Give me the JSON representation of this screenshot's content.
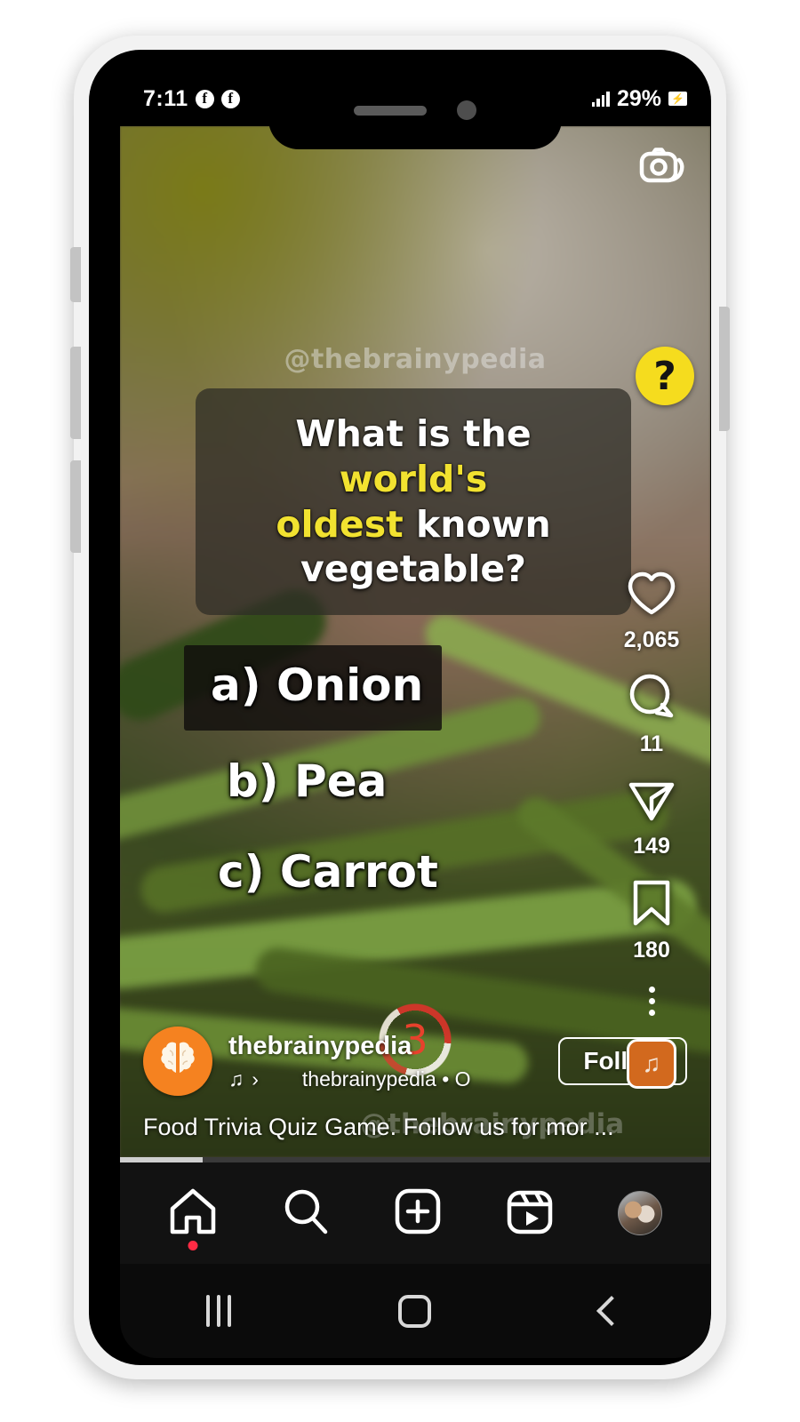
{
  "status_bar": {
    "clock": "7:11",
    "notification_icons": [
      "facebook-icon",
      "facebook-icon"
    ],
    "battery_percent": "29%",
    "signal_icon": "signal-bars-icon",
    "battery_icon": "battery-charging-icon"
  },
  "video": {
    "watermark_top": "@thebrainypedia",
    "watermark_bottom": "@thebrainypedia",
    "camera_icon": "camera-remix-icon"
  },
  "quiz": {
    "badge": "?",
    "question_part1": "What is the ",
    "question_highlight1": "world's",
    "question_highlight2": "oldest",
    "question_part2": " known",
    "question_part3": "vegetable?",
    "answers": [
      {
        "label": "a) Onion"
      },
      {
        "label": "b) Pea"
      },
      {
        "label": "c) Carrot"
      }
    ],
    "countdown": "3"
  },
  "actions": {
    "like": {
      "icon": "heart-icon",
      "count": "2,065"
    },
    "comment": {
      "icon": "comment-icon",
      "count": "11"
    },
    "share": {
      "icon": "send-icon",
      "count": "149"
    },
    "save": {
      "icon": "bookmark-icon",
      "count": "180"
    },
    "more": {
      "icon": "more-options-icon"
    },
    "audio_thumb": {
      "icon": "music-note-icon"
    }
  },
  "post": {
    "username": "thebrainypedia",
    "avatar_icon": "brain-icon",
    "music_icon": "music-note-icon",
    "audio_title": "thebrainypedia • O",
    "follow_label": "Follow",
    "caption": "Food Trivia Quiz Game. Follow us for mor ..."
  },
  "bottom_nav": {
    "items": [
      {
        "name": "home",
        "icon": "home-icon"
      },
      {
        "name": "search",
        "icon": "search-icon"
      },
      {
        "name": "create",
        "icon": "plus-square-icon"
      },
      {
        "name": "reels",
        "icon": "reels-icon"
      },
      {
        "name": "profile",
        "icon": "profile-avatar-icon"
      }
    ]
  },
  "android_nav": {
    "recents": "recents-icon",
    "home": "home-square-icon",
    "back": "back-chevron-icon"
  },
  "colors": {
    "accent_yellow": "#F2E230",
    "badge_yellow": "#F5DC1E",
    "avatar_orange": "#F58220",
    "audio_orange": "#D2691E",
    "notification_red": "#FF2B44",
    "countdown_red": "#E8412C"
  }
}
